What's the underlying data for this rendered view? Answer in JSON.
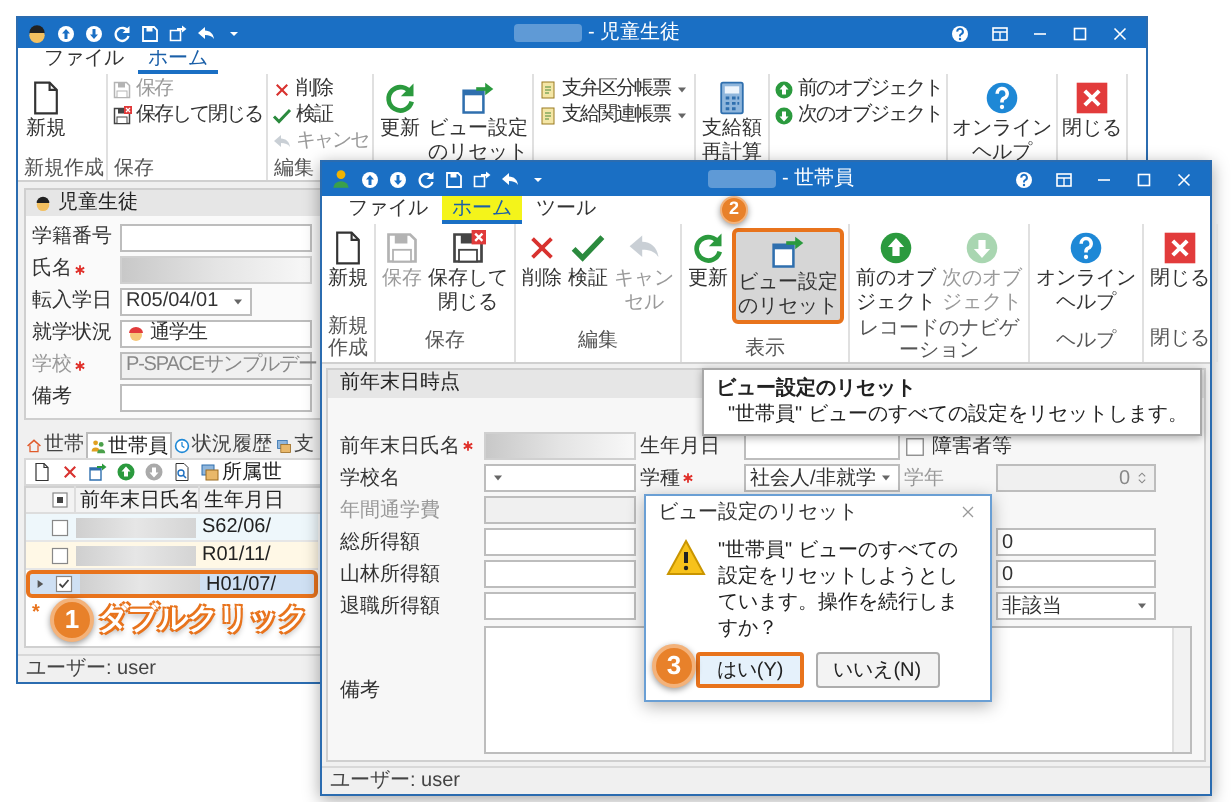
{
  "back_window": {
    "title": "- 児童生徒",
    "menu_tabs": [
      {
        "label": "ファイル",
        "selected": false,
        "highlighted": false
      },
      {
        "label": "ホーム",
        "selected": true,
        "highlighted": false
      }
    ],
    "ribbon_groups": [
      {
        "label": "新規作成",
        "items": [
          {
            "kind": "large",
            "label": "新規",
            "disabled": false
          }
        ]
      },
      {
        "label": "保存",
        "items": [
          {
            "kind": "small",
            "label": "保存",
            "disabled": true
          },
          {
            "kind": "small",
            "label": "保存して閉じる",
            "disabled": false
          }
        ]
      },
      {
        "label": "編集",
        "items": [
          {
            "kind": "small",
            "label": "削除",
            "disabled": false
          },
          {
            "kind": "small",
            "label": "検証",
            "disabled": false
          },
          {
            "kind": "small",
            "label": "キャンセ",
            "disabled": true
          }
        ]
      },
      {
        "items": [
          {
            "kind": "large",
            "label": "更新",
            "disabled": false
          },
          {
            "kind": "large",
            "label": "ビュー設定のリセット",
            "disabled": false
          }
        ]
      },
      {
        "items": [
          {
            "kind": "dropdown",
            "label": "支弁区分帳票",
            "disabled": false
          },
          {
            "kind": "dropdown",
            "label": "支給関連帳票",
            "disabled": false
          }
        ]
      },
      {
        "items": [
          {
            "kind": "large",
            "label": "支給額再計算",
            "disabled": false
          }
        ]
      },
      {
        "items": [
          {
            "kind": "small",
            "label": "前のオブジェクト",
            "disabled": false
          },
          {
            "kind": "small",
            "label": "次のオブジェクト",
            "disabled": false
          }
        ]
      },
      {
        "items": [
          {
            "kind": "large",
            "label": "オンラインヘルプ",
            "disabled": false
          }
        ]
      },
      {
        "items": [
          {
            "kind": "large",
            "label": "閉じる",
            "disabled": false
          }
        ]
      }
    ],
    "panel_title": "児童生徒",
    "fields": [
      {
        "label": "学籍番号",
        "required": false,
        "disabled": false,
        "kind": "text"
      },
      {
        "label": "氏名",
        "required": true,
        "kind": "blurred"
      },
      {
        "label": "転入学日",
        "required": false,
        "disabled": false,
        "kind": "date",
        "value": "R05/04/01"
      },
      {
        "label": "就学状況",
        "required": false,
        "disabled": false,
        "kind": "status",
        "value": "通学生"
      },
      {
        "label": "学校",
        "required": true,
        "disabled": true,
        "kind": "text",
        "value": "P-SPACEサンプルデー"
      },
      {
        "label": "備考",
        "required": false,
        "disabled": false,
        "kind": "text"
      }
    ],
    "detail_tabs": [
      {
        "label": "世帯",
        "selected": false,
        "highlighted": false
      },
      {
        "label": "世帯員",
        "selected": true,
        "highlighted": true
      },
      {
        "label": "状況履歴",
        "selected": false,
        "highlighted": false
      },
      {
        "label": "支",
        "selected": false,
        "highlighted": false
      }
    ],
    "toolbar_label": "所属世",
    "grid": {
      "columns": [
        "前年末日氏名",
        "生年月日"
      ],
      "rows": [
        {
          "checked": false,
          "selected": false,
          "annotated": false,
          "birth_date": "S62/06/"
        },
        {
          "checked": false,
          "selected": false,
          "annotated": false,
          "birth_date": "R01/11/"
        },
        {
          "checked": true,
          "selected": true,
          "annotated": true,
          "birth_date": "H01/07/"
        }
      ],
      "select_all_partial": true,
      "new_row_marker": "*"
    },
    "status_bar": "ユーザー: user"
  },
  "front_window": {
    "title": "- 世帯員",
    "menu_tabs": [
      {
        "label": "ファイル",
        "selected": false,
        "highlighted": false
      },
      {
        "label": "ホーム",
        "selected": true,
        "highlighted": true
      },
      {
        "label": "ツール",
        "selected": false,
        "highlighted": false
      }
    ],
    "ribbon_groups": [
      {
        "label": "新規作成",
        "items": [
          {
            "kind": "large",
            "label": "新規",
            "disabled": false,
            "hovered": false,
            "annotated": false
          }
        ]
      },
      {
        "label": "保存",
        "items": [
          {
            "kind": "large",
            "label": "保存",
            "disabled": true,
            "hovered": false,
            "annotated": false
          },
          {
            "kind": "large",
            "label": "保存して閉じる",
            "disabled": false,
            "hovered": false,
            "annotated": false
          }
        ]
      },
      {
        "label": "編集",
        "items": [
          {
            "kind": "large",
            "label": "削除",
            "disabled": false,
            "hovered": false,
            "annotated": false
          },
          {
            "kind": "large",
            "label": "検証",
            "disabled": false,
            "hovered": false,
            "annotated": false
          },
          {
            "kind": "large",
            "label": "キャンセル",
            "disabled": true,
            "hovered": false,
            "annotated": false
          }
        ]
      },
      {
        "label": "表示",
        "items": [
          {
            "kind": "large",
            "label": "更新",
            "disabled": false,
            "hovered": false,
            "annotated": false
          },
          {
            "kind": "large",
            "label": "ビュー設定のリセット",
            "disabled": false,
            "hovered": true,
            "annotated": true
          }
        ]
      },
      {
        "label": "レコードのナビゲーション",
        "items": [
          {
            "kind": "large",
            "label": "前のオブジェクト",
            "disabled": false,
            "hovered": false,
            "annotated": false
          },
          {
            "kind": "large",
            "label": "次のオブジェクト",
            "disabled": true,
            "hovered": false,
            "annotated": false
          }
        ]
      },
      {
        "label": "ヘルプ",
        "items": [
          {
            "kind": "large",
            "label": "オンラインヘルプ",
            "disabled": false,
            "hovered": false,
            "annotated": false
          }
        ]
      },
      {
        "label": "閉じる",
        "items": [
          {
            "kind": "large",
            "label": "閉じる",
            "disabled": false,
            "hovered": false,
            "annotated": false
          }
        ]
      }
    ],
    "tooltip": {
      "title": "ビュー設定のリセット",
      "text": "\"世帯員\" ビューのすべての設定をリセットします。"
    },
    "panel_title": "前年末日時点",
    "form_rows": [
      [
        {
          "label": "前年末日氏名",
          "required": true,
          "kind": "blurred"
        },
        {
          "label": "生年月日",
          "required": false,
          "disabled": false,
          "kind": "text"
        },
        {
          "label": "障害者等",
          "kind": "check",
          "checked": false
        }
      ],
      [
        {
          "label": "学校名",
          "required": false,
          "disabled": false,
          "kind": "select"
        },
        {
          "label": "学種",
          "required": true,
          "disabled": false,
          "kind": "select",
          "value": "社会人/非就学"
        },
        {
          "label": "学年",
          "required": false,
          "disabled": true,
          "kind": "number",
          "value": "0"
        }
      ],
      [
        {
          "label": "年間通学費",
          "required": false,
          "disabled": true,
          "kind": "text"
        },
        null,
        null
      ],
      [
        {
          "label": "総所得額",
          "required": false,
          "disabled": false,
          "kind": "text"
        },
        null,
        {
          "disabled": false,
          "kind": "text",
          "value": "0"
        }
      ],
      [
        {
          "label": "山林所得額",
          "required": false,
          "disabled": false,
          "kind": "text"
        },
        null,
        {
          "disabled": false,
          "kind": "text",
          "value": "0"
        }
      ],
      [
        {
          "label": "退職所得額",
          "required": false,
          "disabled": false,
          "kind": "text"
        },
        null,
        {
          "disabled": false,
          "kind": "select",
          "value": "非該当"
        }
      ]
    ],
    "memo_label": "備考",
    "status_bar": "ユーザー: user"
  },
  "dialog": {
    "title": "ビュー設定のリセット",
    "message": "\"世帯員\" ビューのすべての設定をリセットしようとしています。操作を続行しますか？",
    "buttons": [
      {
        "label": "はい(Y)",
        "default": true,
        "annotated": true
      },
      {
        "label": "いいえ(N)",
        "default": false,
        "annotated": false
      }
    ]
  },
  "annotations": [
    {
      "number": "1",
      "label": "ダブルクリック"
    },
    {
      "number": "2"
    },
    {
      "number": "3"
    }
  ]
}
